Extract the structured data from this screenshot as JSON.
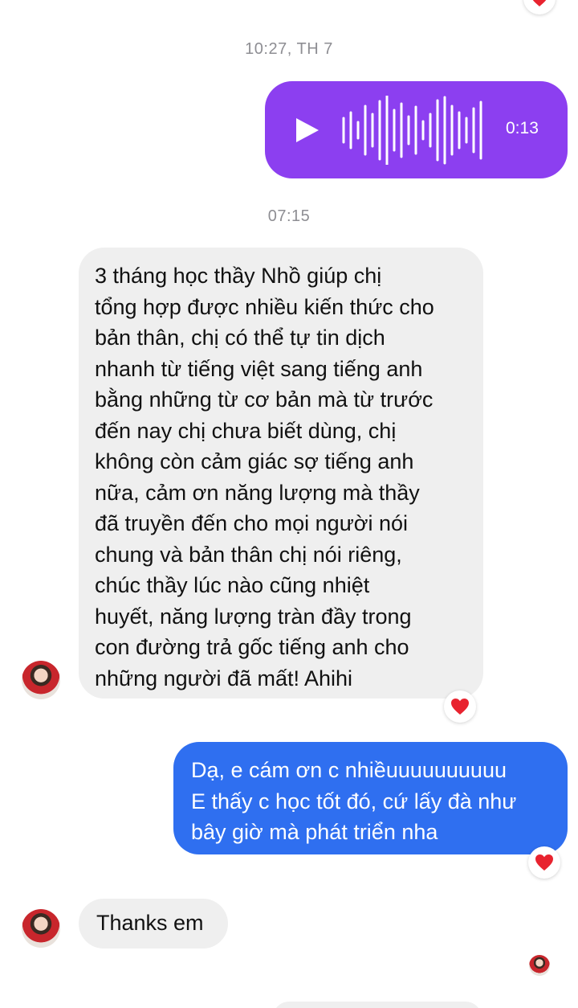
{
  "conversation": {
    "timestamp_1": "10:27, TH 7",
    "voice_message": {
      "duration": "0:13",
      "play_icon": "play-icon",
      "waveform_icon": "waveform-icon",
      "background": "#8c3ff0"
    },
    "timestamp_2": "07:15",
    "incoming_message_1": {
      "lines": [
        "3 tháng học thầy Nhồ giúp chị",
        "tổng hợp được nhiều kiến thức cho",
        "bản thân, chị có thể tự tin dịch",
        "nhanh từ tiếng việt sang tiếng anh",
        "bằng những từ cơ bản mà từ trước",
        "đến nay chị chưa biết dùng, chị",
        "không còn cảm giác sợ tiếng anh",
        "nữa, cảm ơn năng lượng mà thầy",
        "đã truyền đến cho mọi người nói",
        "chung và bản thân chị nói riêng,",
        "chúc thầy lúc nào cũng nhiệt",
        "huyết, năng lượng tràn đầy trong",
        "con đường trả gốc tiếng anh cho",
        "những người đã mất! Ahihi"
      ],
      "reaction": "heart-icon"
    },
    "outgoing_message_1": {
      "lines": [
        "Dạ, e cám ơn c nhiềuuuuuuuuuu",
        "E thấy c học tốt đó, cứ lấy đà như",
        "bây giờ mà phát triển nha"
      ],
      "reaction": "heart-icon",
      "background": "#2f6ff0"
    },
    "incoming_message_2": {
      "text": "Thanks em"
    },
    "colors": {
      "incoming_bubble": "#efefef",
      "timestamp": "#8e8e93",
      "heart": "#e8232f"
    }
  }
}
